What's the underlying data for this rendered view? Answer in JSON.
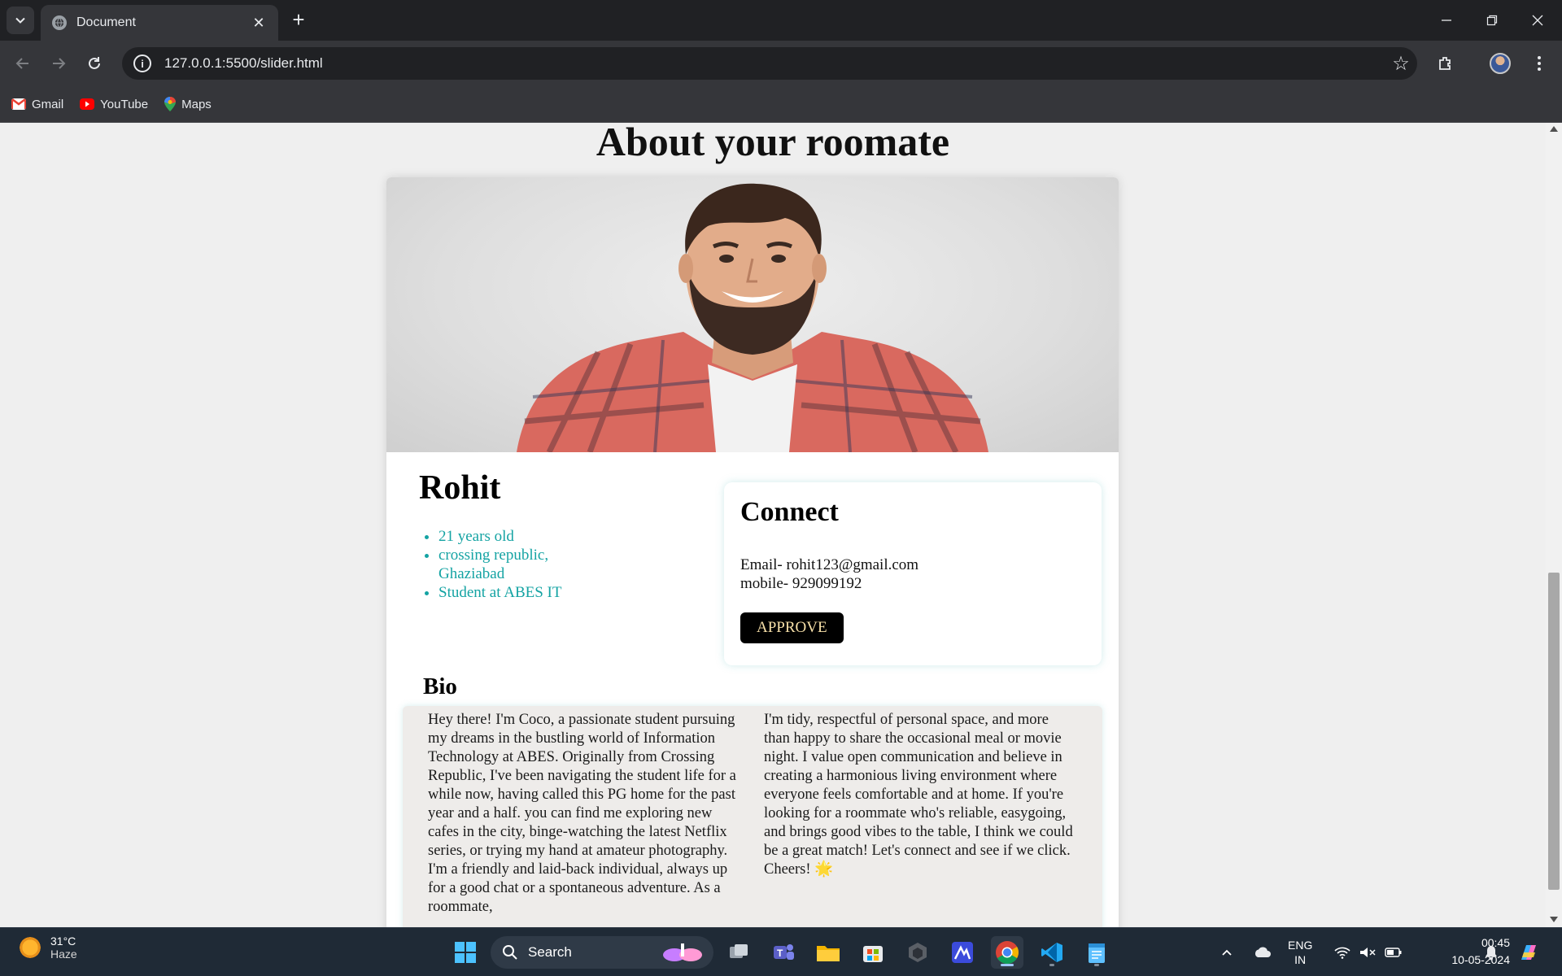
{
  "browser": {
    "tab_title": "Document",
    "url": "127.0.0.1:5500/slider.html",
    "bookmarks": [
      {
        "label": "Gmail",
        "icon": "gmail-icon"
      },
      {
        "label": "YouTube",
        "icon": "youtube-icon"
      },
      {
        "label": "Maps",
        "icon": "maps-icon"
      }
    ]
  },
  "page": {
    "heading": "About your roomate",
    "profile": {
      "name": "Rohit",
      "facts": [
        "21 years old",
        "crossing republic, Ghaziabad",
        "Student at ABES IT"
      ]
    },
    "connect": {
      "title": "Connect",
      "email": "Email- rohit123@gmail.com",
      "mobile": "mobile- 929099192",
      "approve_label": "APPROVE"
    },
    "bio": {
      "title": "Bio",
      "left": "Hey there! I'm Coco, a passionate student pursuing my dreams in the bustling world of Information Technology at ABES. Originally from Crossing Republic, I've been navigating the student life for a while now, having called this PG home for the past year and a half. you can find me exploring new cafes in the city, binge-watching the latest Netflix series, or trying my hand at amateur photography. I'm a friendly and laid-back individual, always up for a good chat or a spontaneous adventure. As a roommate,",
      "right": "I'm tidy, respectful of personal space, and more than happy to share the occasional meal or movie night. I value open communication and believe in creating a harmonious living environment where everyone feels comfortable and at home. If you're looking for a roommate who's reliable, easygoing, and brings good vibes to the table, I think we could be a great match! Let's connect and see if we click. Cheers! 🌟"
    }
  },
  "taskbar": {
    "weather_temp": "31°C",
    "weather_desc": "Haze",
    "search_placeholder": "Search",
    "lang_1": "ENG",
    "lang_2": "IN",
    "time": "00:45",
    "date": "10-05-2024"
  },
  "colors": {
    "accent_teal": "#14a3a3",
    "approve_bg": "#000000",
    "approve_text": "#f7e0a8"
  }
}
